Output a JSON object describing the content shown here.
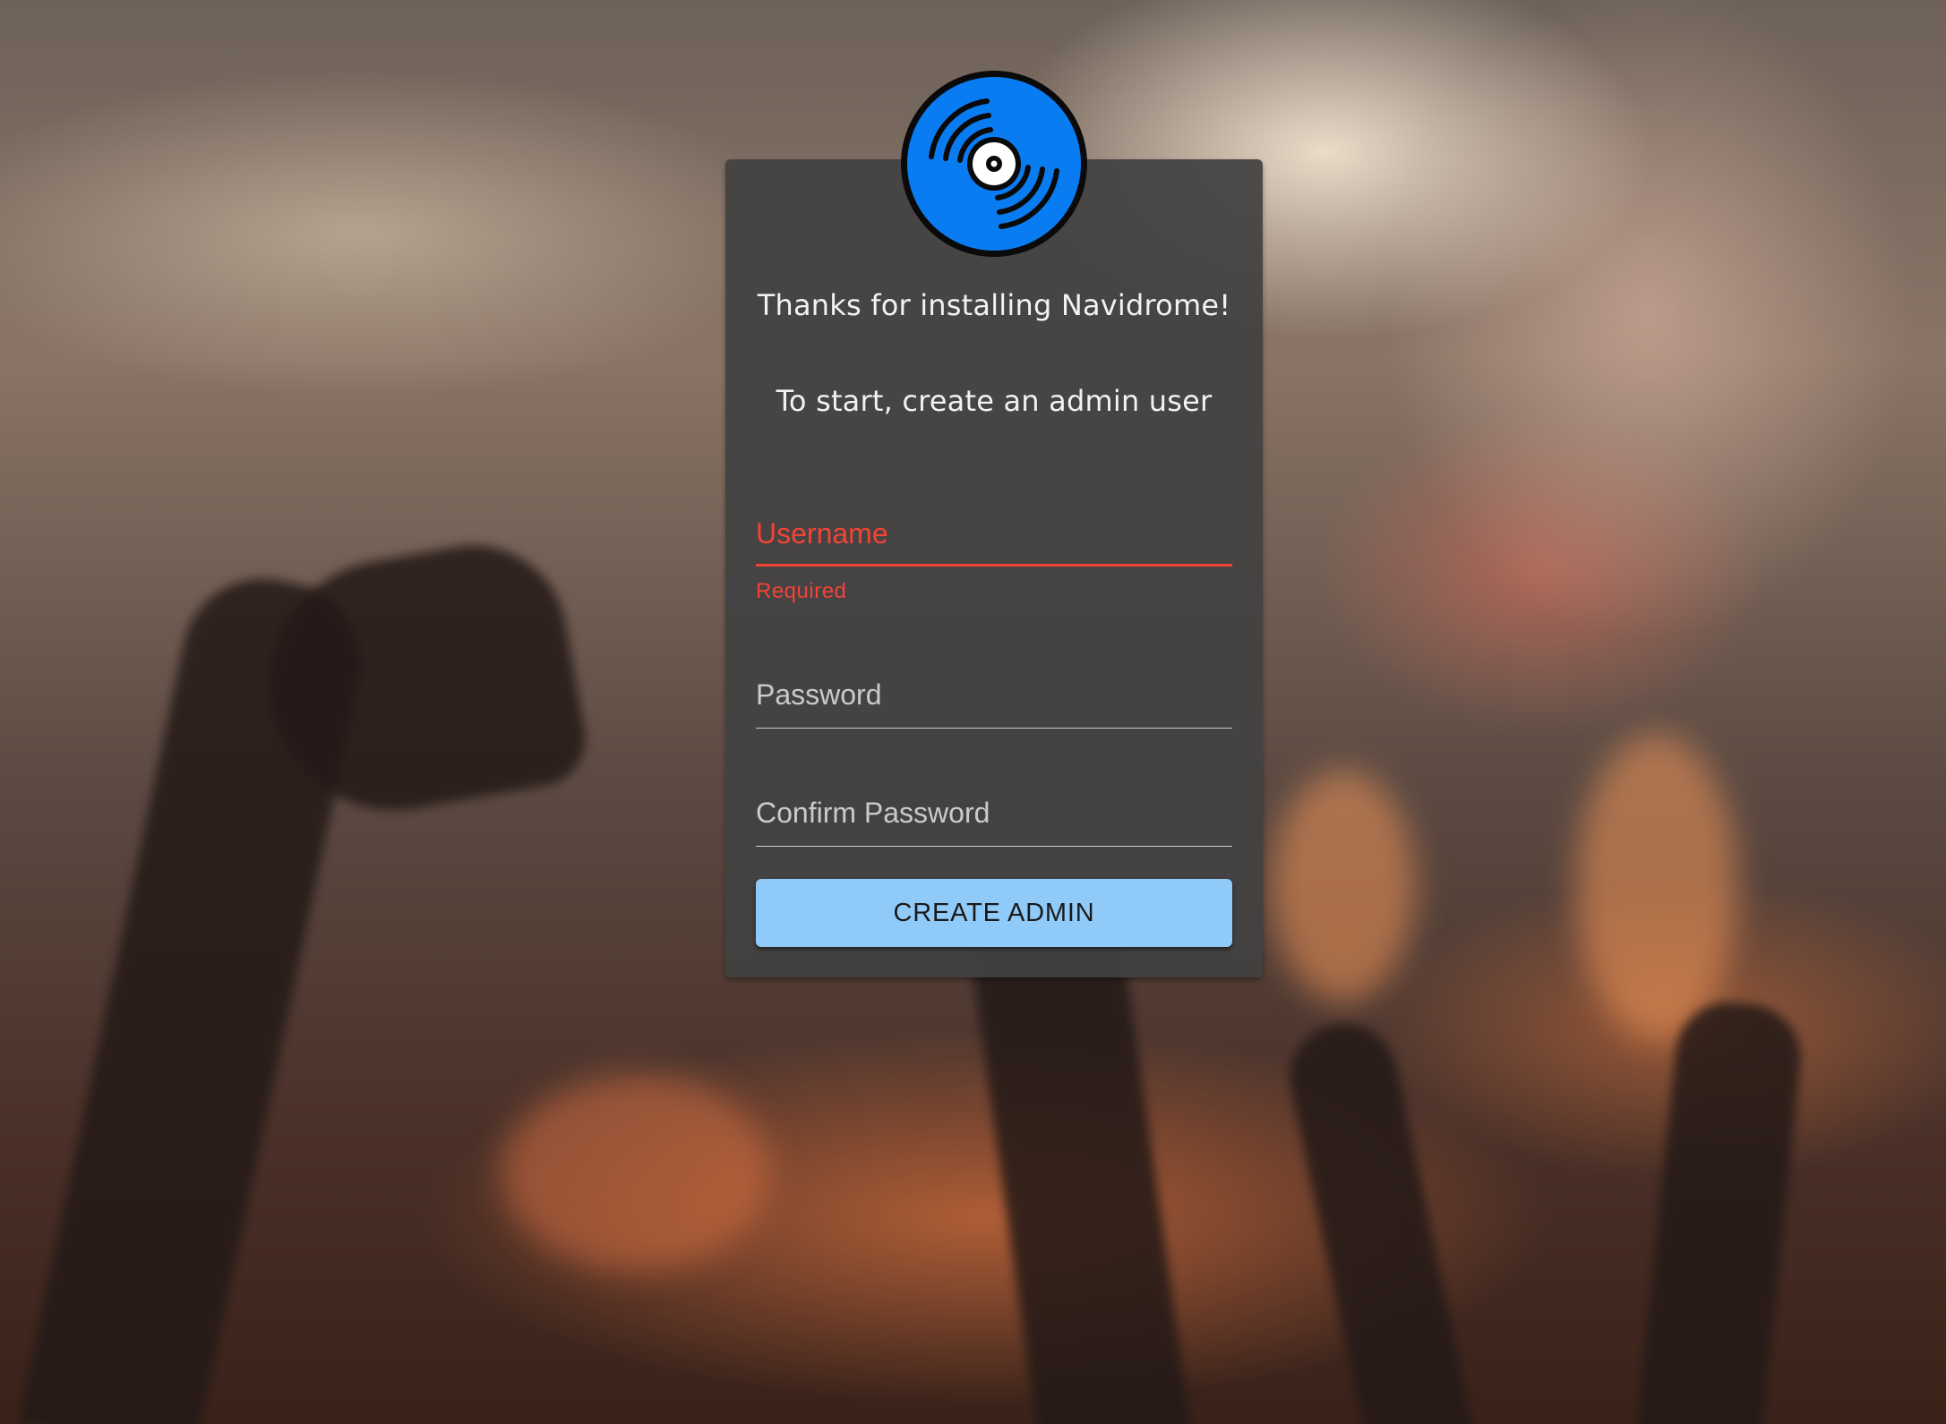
{
  "app": {
    "name": "Navidrome",
    "logo_icon": "vinyl-record-icon",
    "logo_color": "#0a7cf2"
  },
  "header": {
    "welcome_text": "Thanks for installing Navidrome!",
    "instruction_text": "To start, create an admin user"
  },
  "form": {
    "username": {
      "label": "Username",
      "value": "",
      "error": "Required"
    },
    "password": {
      "label": "Password",
      "value": ""
    },
    "confirm_password": {
      "label": "Confirm Password",
      "value": ""
    },
    "submit_label": "CREATE ADMIN"
  },
  "colors": {
    "card_bg": "#424242",
    "error": "#f44336",
    "button": "#90caf9"
  }
}
